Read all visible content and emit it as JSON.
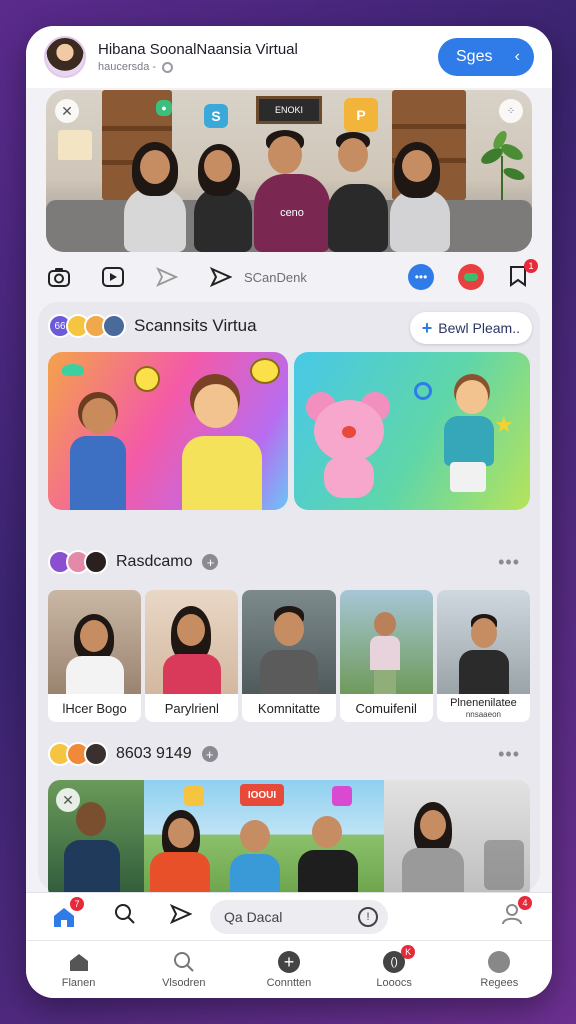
{
  "header": {
    "title": "Hibana SoonalNaansia Virtual",
    "subtitle": "haucersda -",
    "button_label": "Sges",
    "avatar_icon": "profile-avatar"
  },
  "actions": {
    "share_label": "SCanDenk",
    "bookmark_badge": "1"
  },
  "hero": {
    "frame_text": "ENOKI",
    "shirt_text": "ceno"
  },
  "section1": {
    "avatar_badge": "66",
    "title": "Scannsits Virtua",
    "add_button_label": "Bewl Pleam.."
  },
  "section2": {
    "title": "Rasdcamo",
    "cards": [
      {
        "label": "lHcer Bogo"
      },
      {
        "label": "Parylrienl"
      },
      {
        "label": "Komnitatte"
      },
      {
        "label": "Comuifenil"
      },
      {
        "label": "Plnenenilatee",
        "sublabel": "nnsaaeon"
      }
    ]
  },
  "section3": {
    "title": "8603 9149",
    "sign_text": "IOOUI"
  },
  "bottom_bar": {
    "home_badge": "7",
    "search_placeholder": "Qa Dacal",
    "profile_badge": "4"
  },
  "tabs": [
    {
      "label": "Flanen",
      "icon": "home-icon"
    },
    {
      "label": "Vlsodren",
      "icon": "search-icon"
    },
    {
      "label": "Conntten",
      "icon": "plus-circle-icon"
    },
    {
      "label": "Looocs",
      "icon": "chat-icon",
      "badge": "K"
    },
    {
      "label": "Regees",
      "icon": "user-icon"
    }
  ],
  "colors": {
    "accent": "#2f7ce8",
    "badge": "#e8293a",
    "background": "#4a2a80"
  }
}
